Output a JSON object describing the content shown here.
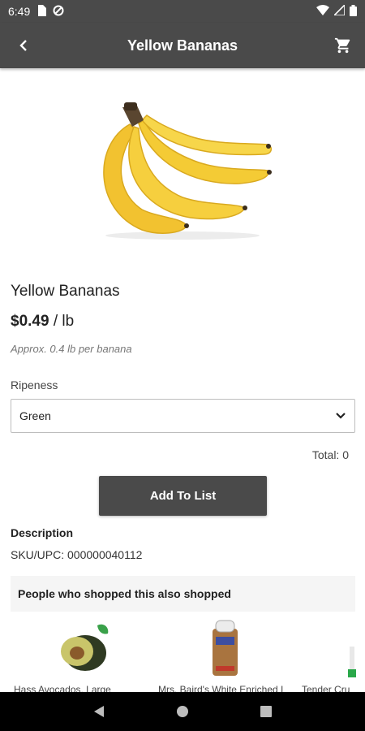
{
  "status_bar": {
    "time": "6:49"
  },
  "app_bar": {
    "title": "Yellow Bananas"
  },
  "product": {
    "name": "Yellow Bananas",
    "price": "$0.49",
    "unit": " / lb",
    "approx": "Approx. 0.4 lb per banana"
  },
  "ripeness": {
    "label": "Ripeness",
    "selected": "Green"
  },
  "total": "Total: 0",
  "add_button": "Add To List",
  "description": {
    "heading": "Description",
    "sku": "SKU/UPC: 000000040112"
  },
  "also_shopped": {
    "heading": "People who shopped this also shopped",
    "items": [
      {
        "label": "Hass Avocados, Large"
      },
      {
        "label": "Mrs. Baird's White Enriched I"
      },
      {
        "label": "Tender Cru"
      }
    ]
  },
  "colors": {
    "bar": "#4a4a4a",
    "nav": "#000000",
    "banana": "#f2c230"
  }
}
